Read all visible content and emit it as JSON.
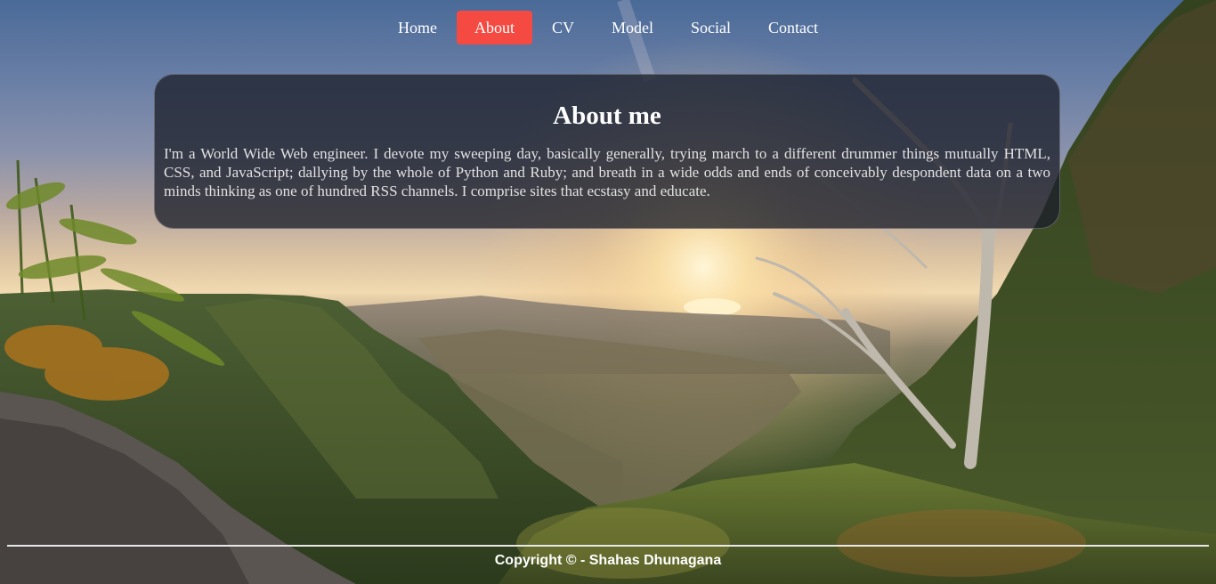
{
  "nav": {
    "items": [
      {
        "label": "Home"
      },
      {
        "label": "About"
      },
      {
        "label": "CV"
      },
      {
        "label": "Model"
      },
      {
        "label": "Social"
      },
      {
        "label": "Contact"
      }
    ],
    "active": "About",
    "active_color": "#f44a41"
  },
  "about": {
    "title": "About me",
    "body": "I'm a World Wide Web engineer. I devote my sweeping day, basically generally, trying march to a different drummer things mutually HTML, CSS, and JavaScript; dallying by the whole of Python and Ruby; and breath in a wide odds and ends of conceivably despondent data on a two minds thinking as one of hundred RSS channels. I comprise sites that ecstasy and educate."
  },
  "footer": {
    "copyright": "Copyright © - Shahas Dhunagana"
  },
  "background": {
    "description_icon": "mountain-sunrise-photo"
  }
}
